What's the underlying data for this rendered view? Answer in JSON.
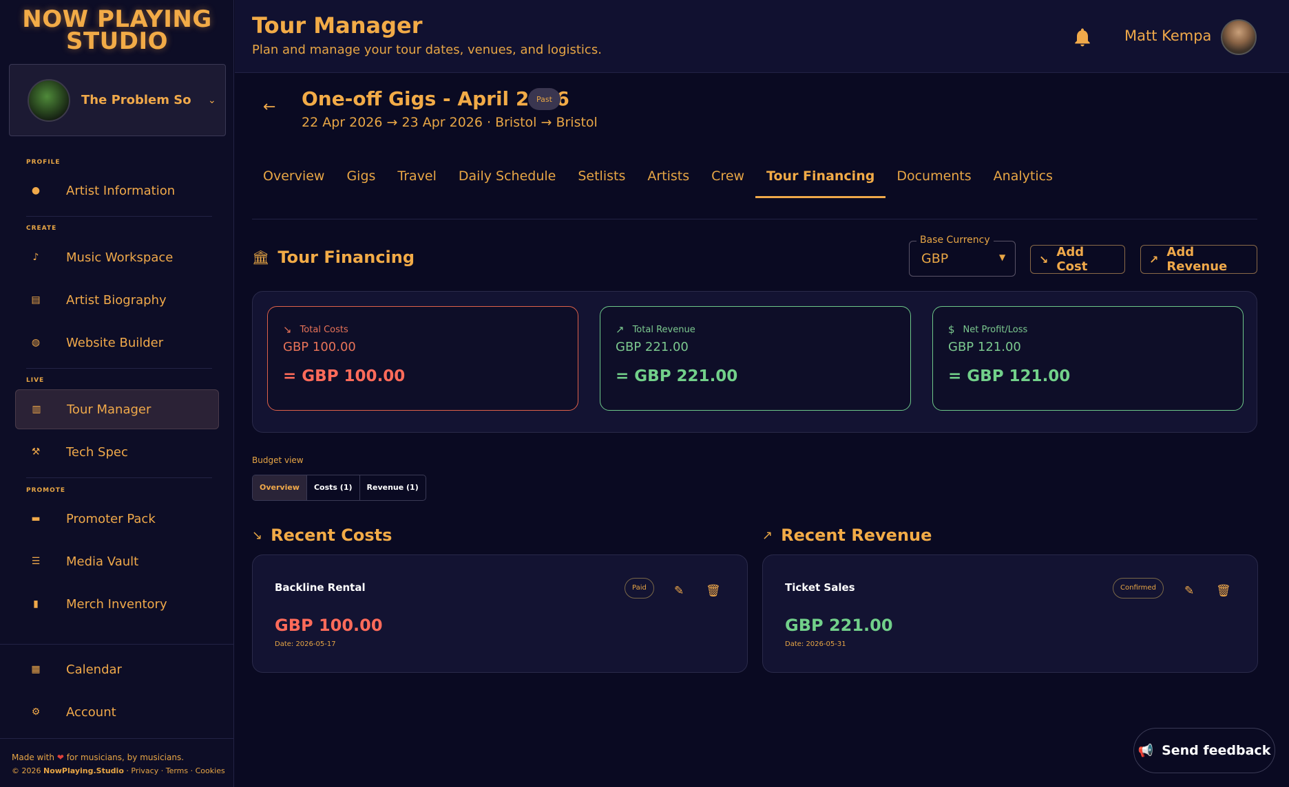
{
  "brand": {
    "line1": "NOW PLAYING",
    "line2": "STUDIO"
  },
  "band": {
    "name": "The Problem So...",
    "chevron": "chevron-down-icon"
  },
  "sidebar": {
    "sections": {
      "profile": "PROFILE",
      "create": "CREATE",
      "live": "LIVE",
      "promote": "PROMOTE"
    },
    "items": [
      {
        "label": "Artist Information",
        "icon": "person-icon",
        "glyph": "👤"
      },
      {
        "label": "Music Workspace",
        "icon": "music-note-icon",
        "glyph": "♪"
      },
      {
        "label": "Artist Biography",
        "icon": "document-icon",
        "glyph": "▤"
      },
      {
        "label": "Website Builder",
        "icon": "globe-icon",
        "glyph": "◍"
      },
      {
        "label": "Tour Manager",
        "icon": "map-icon",
        "glyph": "▥"
      },
      {
        "label": "Tech Spec",
        "icon": "wrench-icon",
        "glyph": "🔧"
      },
      {
        "label": "Promoter Pack",
        "icon": "folder-icon",
        "glyph": "▬"
      },
      {
        "label": "Media Vault",
        "icon": "list-icon",
        "glyph": "☰"
      },
      {
        "label": "Merch Inventory",
        "icon": "bag-icon",
        "glyph": "▮"
      },
      {
        "label": "Calendar",
        "icon": "calendar-icon",
        "glyph": "▦"
      },
      {
        "label": "Account",
        "icon": "gear-icon",
        "glyph": "⚙"
      }
    ],
    "active_index": 4
  },
  "footer": {
    "made_with_prefix": "Made with",
    "made_with_suffix": "for musicians, by musicians.",
    "copyright": "© 2026",
    "brand": "NowPlaying.Studio",
    "links": [
      "Privacy",
      "Terms",
      "Cookies"
    ]
  },
  "header": {
    "title": "Tour Manager",
    "subtitle": "Plan and manage your tour dates, venues, and logistics.",
    "user_name": "Matt Kempa"
  },
  "tour": {
    "title": "One-off Gigs - April 2026",
    "badge": "Past",
    "dates": "22 Apr 2026 → 23 Apr 2026 · Bristol → Bristol"
  },
  "tabs": [
    "Overview",
    "Gigs",
    "Travel",
    "Daily Schedule",
    "Setlists",
    "Artists",
    "Crew",
    "Tour Financing",
    "Documents",
    "Analytics"
  ],
  "active_tab": "Tour Financing",
  "financing": {
    "title": "Tour Financing",
    "currency_label": "Base Currency",
    "currency_value": "GBP",
    "add_cost": "Add Cost",
    "add_revenue": "Add Revenue",
    "stats": {
      "costs": {
        "label": "Total Costs",
        "line1": "GBP 100.00",
        "line2": "= GBP 100.00"
      },
      "revenue": {
        "label": "Total Revenue",
        "line1": "GBP 221.00",
        "line2": "= GBP 221.00"
      },
      "net": {
        "label": "Net Profit/Loss",
        "line1": "GBP 121.00",
        "line2": "= GBP 121.00"
      }
    },
    "budget_view_label": "Budget view",
    "budget_segments": [
      "Overview",
      "Costs (1)",
      "Revenue (1)"
    ],
    "recent_costs_title": "Recent Costs",
    "recent_revenue_title": "Recent Revenue",
    "cost_item": {
      "name": "Backline Rental",
      "status": "Paid",
      "amount": "GBP 100.00",
      "date": "Date: 2026-05-17"
    },
    "revenue_item": {
      "name": "Ticket Sales",
      "status": "Confirmed",
      "amount": "GBP 221.00",
      "date": "Date: 2026-05-31"
    }
  },
  "feedback_button": "Send feedback",
  "colors": {
    "accent": "#f0a94a",
    "background": "#0a0a22",
    "cost_red": "#ff6b5a",
    "revenue_green": "#72d08a"
  }
}
